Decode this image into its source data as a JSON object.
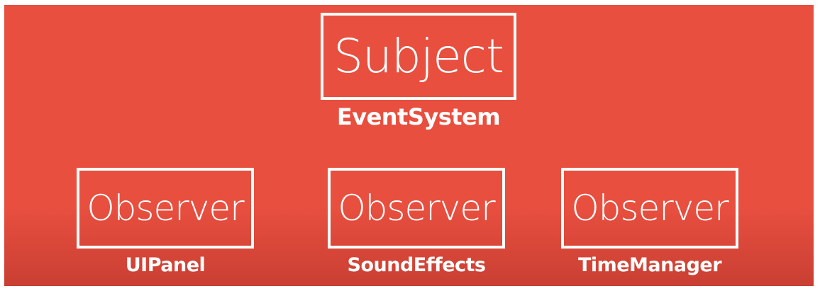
{
  "diagram": {
    "subject": {
      "box_text": "Subject",
      "caption": "EventSystem"
    },
    "observers": [
      {
        "box_text": "Observer",
        "caption": "UIPanel"
      },
      {
        "box_text": "Observer",
        "caption": "SoundEffects"
      },
      {
        "box_text": "Observer",
        "caption": "TimeManager"
      }
    ],
    "colors": {
      "background": "#e84f3f",
      "foreground": "#ffffff"
    }
  }
}
